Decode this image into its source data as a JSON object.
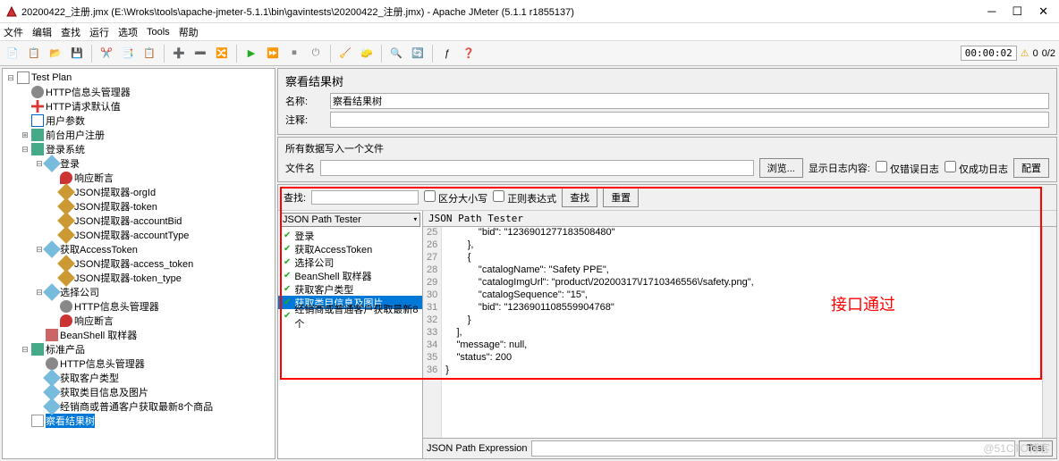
{
  "window": {
    "title": "20200422_注册.jmx (E:\\Wroks\\tools\\apache-jmeter-5.1.1\\bin\\gavintests\\20200422_注册.jmx) - Apache JMeter (5.1.1 r1855137)"
  },
  "menu": [
    "文件",
    "编辑",
    "查找",
    "运行",
    "选项",
    "Tools",
    "帮助"
  ],
  "timer": "00:00:02",
  "counter": "0/2",
  "tree": [
    {
      "d": 0,
      "t": "-",
      "i": "flask",
      "l": "Test Plan"
    },
    {
      "d": 1,
      "t": "",
      "i": "gear",
      "l": "HTTP信息头管理器"
    },
    {
      "d": 1,
      "t": "",
      "i": "cross",
      "l": "HTTP请求默认值"
    },
    {
      "d": 1,
      "t": "",
      "i": "table",
      "l": "用户参数"
    },
    {
      "d": 1,
      "t": "+",
      "i": "toggle",
      "l": "前台用户注册"
    },
    {
      "d": 1,
      "t": "-",
      "i": "toggle",
      "l": "登录系统"
    },
    {
      "d": 2,
      "t": "-",
      "i": "dropper",
      "l": "登录"
    },
    {
      "d": 3,
      "t": "",
      "i": "pin",
      "l": "响应断言"
    },
    {
      "d": 3,
      "t": "",
      "i": "pencil",
      "l": "JSON提取器-orgId"
    },
    {
      "d": 3,
      "t": "",
      "i": "pencil",
      "l": "JSON提取器-token"
    },
    {
      "d": 3,
      "t": "",
      "i": "pencil",
      "l": "JSON提取器-accountBid"
    },
    {
      "d": 3,
      "t": "",
      "i": "pencil",
      "l": "JSON提取器-accountType"
    },
    {
      "d": 2,
      "t": "-",
      "i": "dropper",
      "l": "获取AccessToken"
    },
    {
      "d": 3,
      "t": "",
      "i": "pencil",
      "l": "JSON提取器-access_token"
    },
    {
      "d": 3,
      "t": "",
      "i": "pencil",
      "l": "JSON提取器-token_type"
    },
    {
      "d": 2,
      "t": "-",
      "i": "dropper",
      "l": "选择公司"
    },
    {
      "d": 3,
      "t": "",
      "i": "gear",
      "l": "HTTP信息头管理器"
    },
    {
      "d": 3,
      "t": "",
      "i": "pin",
      "l": "响应断言"
    },
    {
      "d": 2,
      "t": "",
      "i": "wand",
      "l": "BeanShell 取样器"
    },
    {
      "d": 1,
      "t": "-",
      "i": "toggle",
      "l": "标准产品"
    },
    {
      "d": 2,
      "t": "",
      "i": "gear",
      "l": "HTTP信息头管理器"
    },
    {
      "d": 2,
      "t": "",
      "i": "dropper",
      "l": "获取客户类型"
    },
    {
      "d": 2,
      "t": "",
      "i": "dropper",
      "l": "获取类目信息及图片"
    },
    {
      "d": 2,
      "t": "",
      "i": "dropper",
      "l": "经销商或普通客户获取最新8个商品"
    },
    {
      "d": 1,
      "t": "",
      "i": "graph",
      "l": "察看结果树",
      "sel": true
    }
  ],
  "panel": {
    "title": "察看结果树",
    "name_label": "名称:",
    "name_value": "察看结果树",
    "comment_label": "注释:",
    "comment_value": ""
  },
  "file_group": {
    "title": "所有数据写入一个文件",
    "filename_label": "文件名",
    "browse": "浏览...",
    "log_label": "显示日志内容:",
    "err_only": "仅错误日志",
    "succ_only": "仅成功日志",
    "config": "配置"
  },
  "search": {
    "label": "查找:",
    "case": "区分大小写",
    "regex": "正则表达式",
    "search_btn": "查找",
    "reset_btn": "重置"
  },
  "renderer": "JSON Path Tester",
  "tab_label": "JSON Path Tester",
  "samples": [
    {
      "l": "登录"
    },
    {
      "l": "获取AccessToken"
    },
    {
      "l": "选择公司"
    },
    {
      "l": "BeanShell 取样器"
    },
    {
      "l": "获取客户类型"
    },
    {
      "l": "获取类目信息及图片",
      "sel": true
    },
    {
      "l": "经销商或普通客户获取最新8个"
    }
  ],
  "code": {
    "start": 25,
    "lines": [
      "            \"bid\": \"1236901277183508480\"",
      "        },",
      "        {",
      "            \"catalogName\": \"Safety PPE\",",
      "            \"catalogImgUrl\": \"product\\/20200317\\/1710346556\\/safety.png\",",
      "            \"catalogSequence\": \"15\",",
      "            \"bid\": \"1236901108559904768\"",
      "        }",
      "    ],",
      "    \"message\": null,",
      "    \"status\": 200",
      "}"
    ]
  },
  "expr": {
    "label": "JSON Path Expression",
    "test": "Test"
  },
  "annotation": "接口通过",
  "watermark": "@51CTO博客"
}
